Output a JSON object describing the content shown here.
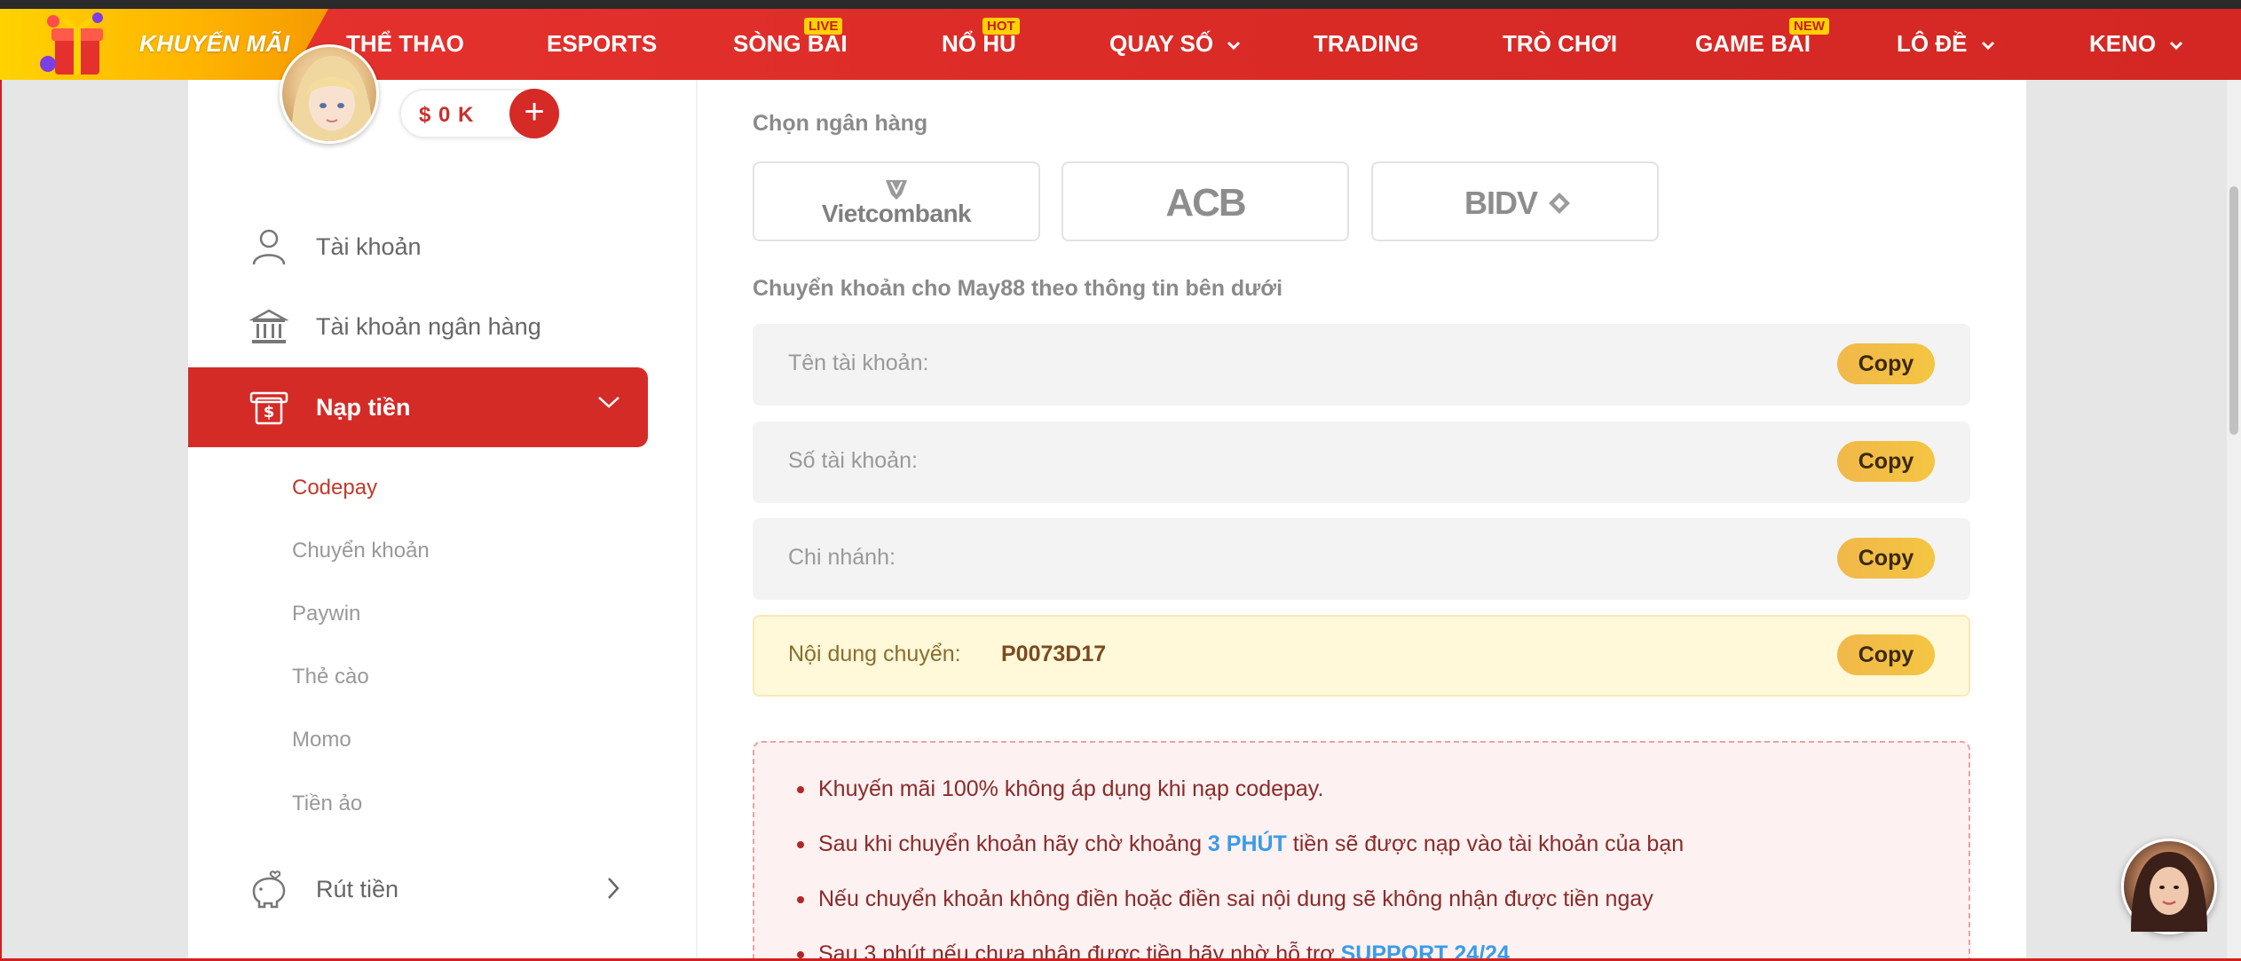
{
  "nav": {
    "promo_label": "KHUYẾN MÃI",
    "items": [
      {
        "label": "THỂ THAO",
        "badge": "",
        "dropdown": false
      },
      {
        "label": "ESPORTS",
        "badge": "",
        "dropdown": false
      },
      {
        "label": "SÒNG BÀI",
        "badge": "LIVE",
        "dropdown": false
      },
      {
        "label": "NỔ HŨ",
        "badge": "HOT",
        "dropdown": false
      },
      {
        "label": "QUAY SỐ",
        "badge": "",
        "dropdown": true
      },
      {
        "label": "TRADING",
        "badge": "",
        "dropdown": false
      },
      {
        "label": "TRÒ CHƠI",
        "badge": "",
        "dropdown": false
      },
      {
        "label": "GAME BÀI",
        "badge": "NEW",
        "dropdown": false
      },
      {
        "label": "LÔ ĐỀ",
        "badge": "",
        "dropdown": true
      },
      {
        "label": "KENO",
        "badge": "",
        "dropdown": true
      }
    ],
    "accent_color": "#d92a26",
    "badge_color": "#ffd200"
  },
  "sidebar": {
    "balance": "$ 0 K",
    "add_symbol": "+",
    "items": [
      {
        "label": "Tài khoản",
        "icon": "user-icon"
      },
      {
        "label": "Tài khoản ngân hàng",
        "icon": "bank-icon"
      },
      {
        "label": "Nạp tiền",
        "icon": "deposit-icon"
      },
      {
        "label": "Rút tiền",
        "icon": "piggy-bank-icon"
      }
    ],
    "sub_items": [
      "Codepay",
      "Chuyển khoản",
      "Paywin",
      "Thẻ cào",
      "Momo",
      "Tiền ảo"
    ]
  },
  "main": {
    "choose_bank_title": "Chọn ngân hàng",
    "banks": [
      "Vietcombank",
      "ACB",
      "BIDV"
    ],
    "transfer_title": "Chuyển khoản cho May88 theo thông tin bên dưới",
    "fields": [
      {
        "label": "Tên tài khoản:",
        "value": ""
      },
      {
        "label": "Số tài khoản:",
        "value": ""
      },
      {
        "label": "Chi nhánh:",
        "value": ""
      },
      {
        "label": "Nội dung chuyển:",
        "value": "P0073D17"
      }
    ],
    "copy_label": "Copy",
    "notes": [
      {
        "pre": "Khuyến mãi 100% không áp dụng khi nạp codepay.",
        "em": "",
        "post": ""
      },
      {
        "pre": "Sau khi chuyển khoản hãy chờ khoảng ",
        "em": "3 PHÚT",
        "post": " tiền sẽ được nạp vào tài khoản của bạn"
      },
      {
        "pre": "Nếu chuyển khoản không điền hoặc điền sai nội dung sẽ không nhận được tiền ngay",
        "em": "",
        "post": ""
      },
      {
        "pre": "Sau 3 phút nếu chưa nhận được tiền hãy nhờ hỗ trợ ",
        "em": "SUPPORT 24/24",
        "post": ""
      }
    ]
  }
}
